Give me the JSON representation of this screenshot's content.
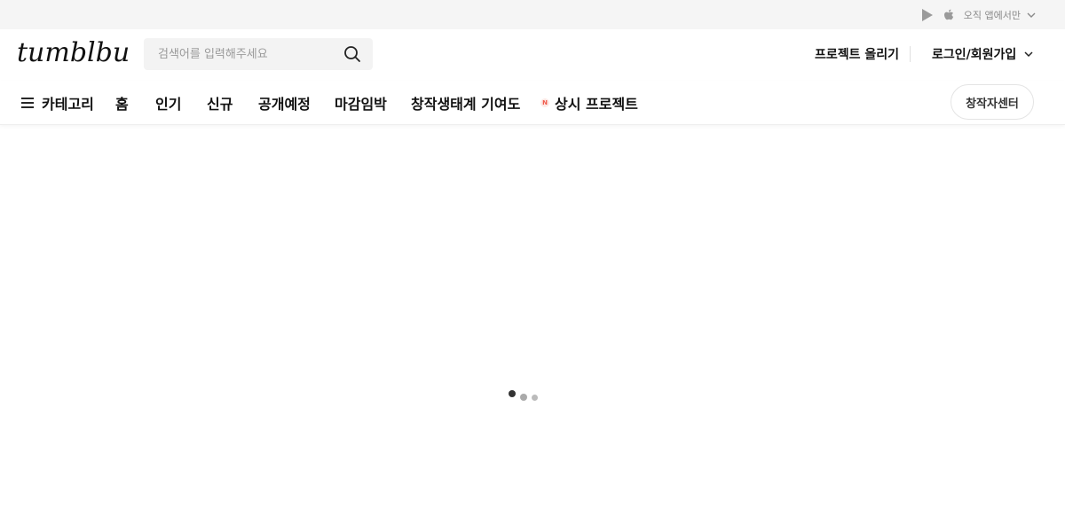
{
  "topbar": {
    "app_only_label": "오직 앱에서만",
    "icons": [
      "google-play-icon",
      "apple-icon",
      "chevron-down-icon"
    ]
  },
  "header": {
    "logo_text": "tumblbug",
    "search_placeholder": "검색어를 입력해주세요",
    "upload_project_label": "프로젝트 올리기",
    "login_signup_label": "로그인/회원가입"
  },
  "nav": {
    "items": [
      {
        "label": "카테고리"
      },
      {
        "label": "홈"
      },
      {
        "label": "인기"
      },
      {
        "label": "신규"
      },
      {
        "label": "공개예정"
      },
      {
        "label": "마감임박"
      },
      {
        "label": "창작생태계 기여도"
      },
      {
        "label": "상시 프로젝트",
        "badge": "N"
      }
    ],
    "creator_center_label": "창작자센터"
  },
  "loader": {
    "dots": 3
  },
  "colors": {
    "topbar_bg": "#f5f5f5",
    "search_bg": "#f3f3f3",
    "new_badge": "#f0594a",
    "text": "#111111"
  }
}
